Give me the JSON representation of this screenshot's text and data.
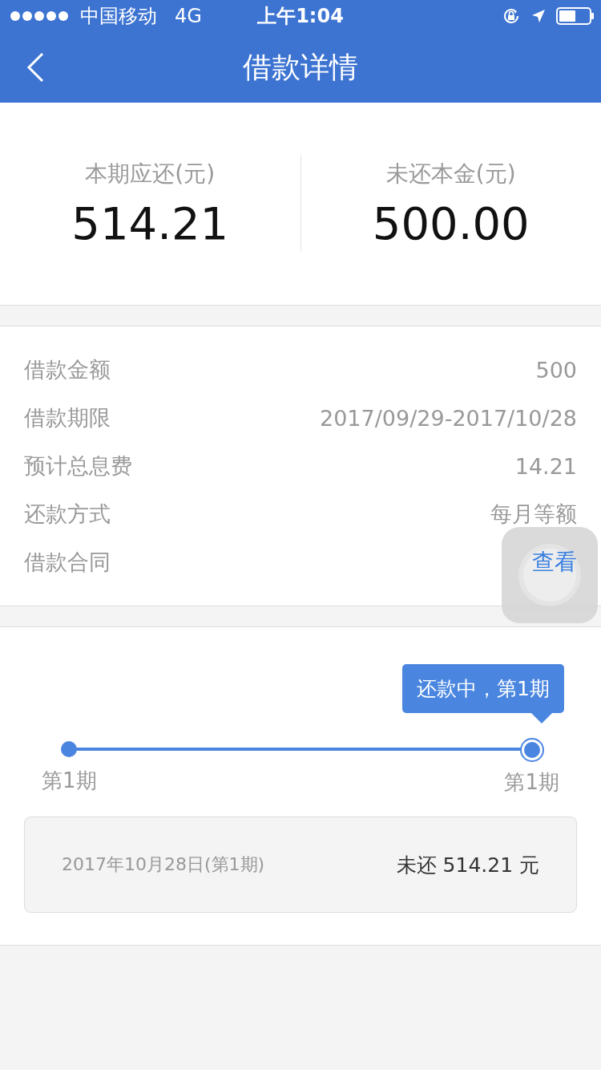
{
  "status_bar": {
    "carrier": "中国移动",
    "network": "4G",
    "time": "上午1:04"
  },
  "nav": {
    "title": "借款详情"
  },
  "summary": [
    {
      "label": "本期应还(元)",
      "value": "514.21"
    },
    {
      "label": "未还本金(元)",
      "value": "500.00"
    }
  ],
  "details": [
    {
      "label": "借款金额",
      "value": "500",
      "kind": "text"
    },
    {
      "label": "借款期限",
      "value": "2017/09/29-2017/10/28",
      "kind": "text"
    },
    {
      "label": "预计总息费",
      "value": "14.21",
      "kind": "text"
    },
    {
      "label": "还款方式",
      "value": "每月等额",
      "kind": "text"
    },
    {
      "label": "借款合同",
      "value": "查看",
      "kind": "link"
    }
  ],
  "timeline": {
    "tooltip": "还款中，第1期",
    "nodes": [
      {
        "label": "第1期",
        "selected": false
      },
      {
        "label": "第1期",
        "selected": true
      }
    ]
  },
  "bill": {
    "date": "2017年10月28日(第1期)",
    "amount": "未还 514.21 元"
  }
}
